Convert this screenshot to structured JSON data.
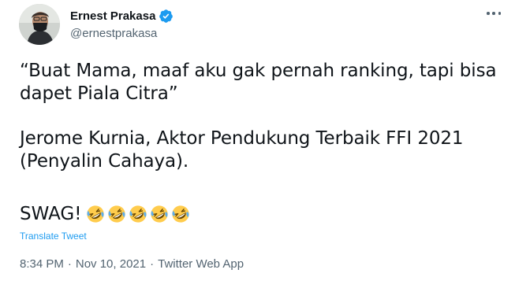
{
  "author": {
    "display_name": "Ernest Prakasa",
    "handle": "@ernestprakasa",
    "verified_color": "#1d9bf0"
  },
  "tweet": {
    "paragraph_1": "“Buat Mama, maaf aku gak pernah ranking, tapi bisa\ndapet Piala Citra”",
    "paragraph_2": "Jerome Kurnia, Aktor Pendukung Terbaik FFI 2021\n(Penyalin Cahaya).",
    "swag_text": "SWAG!",
    "emojis": [
      "rolling-on-floor-laughing",
      "rolling-on-floor-laughing",
      "rolling-on-floor-laughing",
      "rolling-on-floor-laughing",
      "rolling-on-floor-laughing"
    ],
    "translate_label": "Translate Tweet"
  },
  "meta": {
    "time": "8:34 PM",
    "separator_1": "·",
    "date": "Nov 10, 2021",
    "separator_2": "·",
    "source": "Twitter Web App"
  },
  "icons": {
    "more": "more-icon",
    "verified": "verified-badge-icon"
  }
}
